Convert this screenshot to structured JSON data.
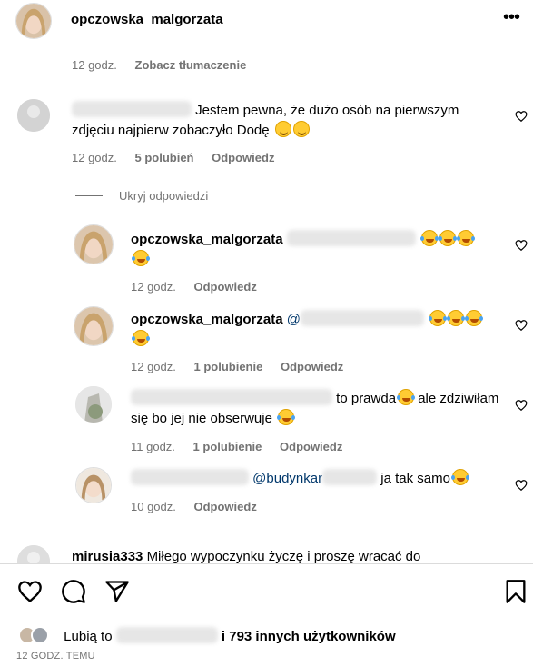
{
  "header": {
    "username": "opczowska_malgorzata",
    "more_icon": "ellipsis-icon"
  },
  "caption_meta": {
    "time": "12 godz.",
    "translate": "Zobacz tłumaczenie"
  },
  "comment_main": {
    "text": "Jestem pewna, że dużo osób na pierwszym zdjęciu najpierw zobaczyło Dodę",
    "time": "12 godz.",
    "likes": "5 polubień",
    "reply": "Odpowiedz"
  },
  "hide_replies": "Ukryj odpowiedzi",
  "replies": [
    {
      "user": "opczowska_malgorzata",
      "time": "12 godz.",
      "reply": "Odpowiedz"
    },
    {
      "user": "opczowska_malgorzata",
      "mention": "@",
      "time": "12 godz.",
      "likes": "1 polubienie",
      "reply": "Odpowiedz"
    },
    {
      "text_a": "to prawda",
      "text_b": "ale zdziwiłam się bo jej nie obserwuje",
      "time": "11 godz.",
      "likes": "1 polubienie",
      "reply": "Odpowiedz"
    },
    {
      "mention": "@budynkar",
      "text": "ja tak samo",
      "time": "10 godz.",
      "reply": "Odpowiedz"
    }
  ],
  "cut_comment": {
    "user": "mirusia333",
    "text": "Miłego wypoczynku życzę i proszę wracać do"
  },
  "actions": {
    "like": "heart-icon",
    "comment": "comment-icon",
    "share": "share-icon",
    "save": "bookmark-icon"
  },
  "likes_summary": {
    "prefix": "Lubią to",
    "suffix": "i 793 innych użytkowników"
  },
  "footer_time": "12 GODZ. TEMU"
}
